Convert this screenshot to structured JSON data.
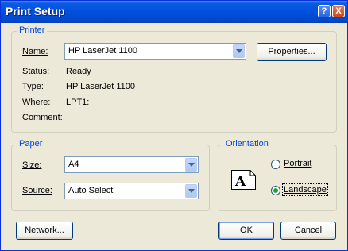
{
  "title": "Print Setup",
  "title_buttons": {
    "help": "?",
    "close": "X"
  },
  "printer": {
    "group_label": "Printer",
    "name_label": "Name:",
    "name_value": "HP LaserJet 1100",
    "properties_button": "Properties...",
    "status_label": "Status:",
    "status_value": "Ready",
    "type_label": "Type:",
    "type_value": "HP LaserJet 1100",
    "where_label": "Where:",
    "where_value": "LPT1:",
    "comment_label": "Comment:"
  },
  "paper": {
    "group_label": "Paper",
    "size_label": "Size:",
    "size_value": "A4",
    "source_label": "Source:",
    "source_value": "Auto Select"
  },
  "orientation": {
    "group_label": "Orientation",
    "icon_letter": "A",
    "portrait_label": "Portrait",
    "landscape_label": "Landscape",
    "selected": "Landscape"
  },
  "buttons": {
    "network": "Network...",
    "ok": "OK",
    "cancel": "Cancel"
  }
}
